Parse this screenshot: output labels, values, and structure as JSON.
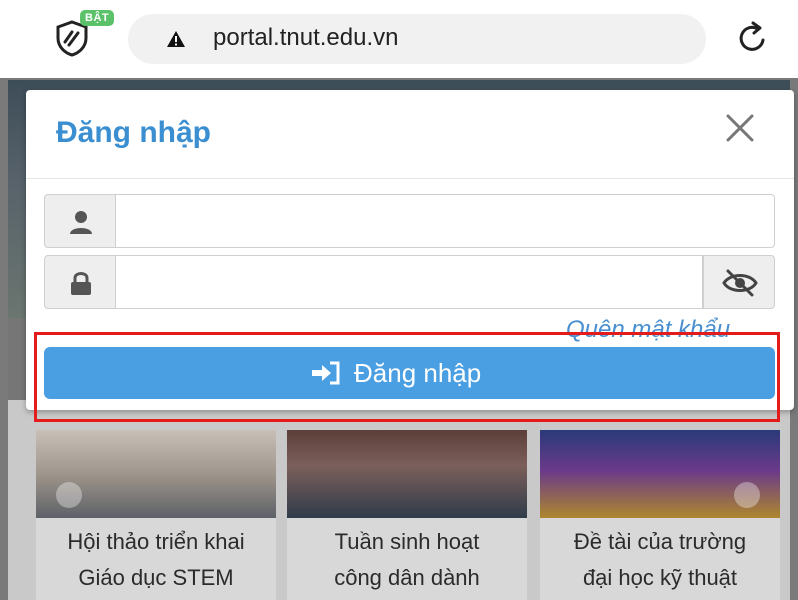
{
  "browser": {
    "url": "portal.tnut.edu.vn",
    "badge": "BẬT",
    "shield_icon": "shield-icon",
    "warning_icon": "warning-icon",
    "reload_icon": "reload-icon"
  },
  "modal": {
    "title": "Đăng nhập",
    "close_icon": "close-icon",
    "username": {
      "value": "",
      "placeholder": "",
      "icon": "user-icon"
    },
    "password": {
      "value": "",
      "placeholder": "",
      "icon": "lock-icon",
      "toggle_icon": "eye-slash-icon"
    },
    "forgot_label": "Quên mật khẩu",
    "login_label": "Đăng nhập",
    "login_icon": "sign-in-icon"
  },
  "news": {
    "items": [
      {
        "caption_line1": "Hội thảo triển khai",
        "caption_line2": "Giáo dục STEM"
      },
      {
        "caption_line1": "Tuần sinh hoạt",
        "caption_line2": "công dân dành"
      },
      {
        "caption_line1": "Đề tài của trường",
        "caption_line2": "đại học kỹ thuật"
      }
    ]
  },
  "colors": {
    "accent": "#4a9ee2",
    "title": "#3b8fd1",
    "highlight": "#e31b1b",
    "badge": "#5bc26a"
  }
}
